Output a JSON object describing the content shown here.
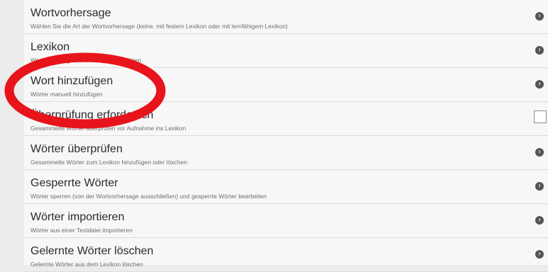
{
  "settings": {
    "items": [
      {
        "title": "Wortvorhersage",
        "subtitle": "Wählen Sie die Art der Wortvorhersage (keine, mit festem Lexikon oder mit lernfähigem Lexikon)",
        "control": "chevron"
      },
      {
        "title": "Lexikon",
        "subtitle": "Wortvorhersagelexikon / -sprache wählen",
        "control": "chevron"
      },
      {
        "title": "Wort hinzufügen",
        "subtitle": "Wörter manuell hinzufügen",
        "control": "chevron"
      },
      {
        "title": "Überprüfung erforderlich",
        "subtitle": "Gesammelte Wörter überprüfen vor Aufnahme ins Lexikon",
        "control": "checkbox",
        "checked": false
      },
      {
        "title": "Wörter überprüfen",
        "subtitle": "Gesammelte Wörter zum Lexikon hinzufügen oder löschen",
        "control": "chevron"
      },
      {
        "title": "Gesperrte Wörter",
        "subtitle": "Wörter sperren (von der Wortvorhersage ausschließen) und gesperrte Wörter bearbeiten",
        "control": "chevron"
      },
      {
        "title": "Wörter importieren",
        "subtitle": "Wörter aus einer Textdatei importieren",
        "control": "chevron"
      },
      {
        "title": "Gelernte Wörter löschen",
        "subtitle": "Gelernte Wörter aus dem Lexikon löschen",
        "control": "chevron"
      }
    ]
  },
  "annotation": {
    "color": "#e8141c",
    "highlighted_item": "Wort hinzufügen"
  },
  "icons": {
    "chevron": "chevron-right-icon",
    "checkbox": "checkbox-icon"
  }
}
